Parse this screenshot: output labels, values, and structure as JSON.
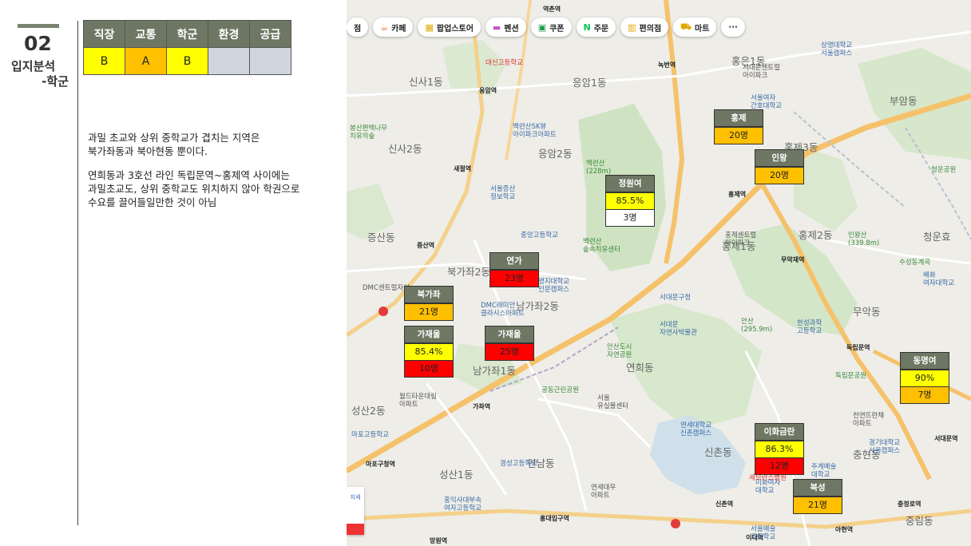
{
  "section": {
    "number": "02",
    "title_line1": "입지분석",
    "title_line2": "-학군"
  },
  "score_table": {
    "headers": [
      "직장",
      "교통",
      "학군",
      "환경",
      "공급"
    ],
    "grades": [
      "B",
      "A",
      "B",
      "",
      ""
    ]
  },
  "description": {
    "para1_line1": "과밀 초교와 상위 중학교가 겹치는 지역은",
    "para1_line2": "북가좌동과 북아현동 뿐이다.",
    "para2_line1": "연희동과 3호선 라인 독립문역~홍제역 사이에는",
    "para2_line2": "과밀초교도, 상위 중학교도 위치하지 않아 학권으로",
    "para2_line3": "수요를 끌어들일만한 것이 아님"
  },
  "chips": [
    "점",
    "카페",
    "팝업스토어",
    "펜션",
    "쿠폰",
    "주문",
    "편의점",
    "마트",
    "···"
  ],
  "areas": {
    "a1": "신사1동",
    "a2": "응암1동",
    "a3": "홍은1동",
    "a4": "신사2동",
    "a5": "응암2동",
    "a6": "부암동",
    "a7": "증산동",
    "a8": "북가좌2동",
    "a9": "홍제1동",
    "a10": "홍제2동",
    "a11": "청운효",
    "a12": "남가좌2동",
    "a13": "무악동",
    "a14": "남가좌1동",
    "a15": "연희동",
    "a16": "성산2동",
    "a17": "신촌동",
    "a18": "충현동",
    "a19": "성산1동",
    "a20": "연남동",
    "a21": "중림동",
    "a22": "홍제3동"
  },
  "stations": {
    "s1": "녹번역",
    "s2": "응암역",
    "s3": "새절역",
    "s4": "증산역",
    "s5": "홍제역",
    "s6": "무악재역",
    "s7": "독립문역",
    "s8": "가좌역",
    "s9": "마포구청역",
    "s10": "신촌역",
    "s11": "이대역",
    "s12": "아현역",
    "s13": "홍대입구역",
    "s14": "서대문역",
    "s15": "충정로역",
    "s16": "망원역",
    "s17": "역촌역"
  },
  "pois": {
    "p1": "백련산SK뷰\n아이파크아파트",
    "p2": "중앙고등학교",
    "p3": "DMC래미안\n클라시스아파트",
    "p4": "명지대학교\n인문캠퍼스",
    "p5": "서대문구청",
    "p6": "서대문\n자연사박물관",
    "p7": "안산도시\n자연공원",
    "p8": "연세대학교\n신촌캠퍼스",
    "p9": "경성고등학교",
    "p10": "홍익사대부속\n여자고등학교",
    "p11": "연세대우\n아파트",
    "p12": "이화여자\n대학교",
    "p13": "경기대학교\n서울캠퍼스",
    "p14": "한성과학\n고등학교",
    "p15": "독립문공원",
    "p16": "DMC센트럴자이",
    "p17": "월드타운대림\n아파트",
    "p18": "상명대학교\n서울캠퍼스",
    "p19": "서울예술\n고등학교",
    "p20": "홍제센트럴\n아이파크",
    "p21": "서대문센트럴\n아이파크",
    "p22": "서울여자\n간호대학교",
    "p23": "백련산\n숲속치유센터",
    "p24": "궁동근린공원",
    "p25": "마포고등학교",
    "p26": "서울증산\n정보학교",
    "p27": "세브란스병원",
    "p28": "천연뜨란채\n아파트",
    "p29": "인왕산\n(339.8m)",
    "p30": "안산\n(295.9m)",
    "p31": "백련산\n(228m)",
    "p32": "봉산편백나무\n치유의숲",
    "p33": "수성동계곡",
    "p34": "배화\n여자대학교",
    "p35": "청운공원",
    "p36": "녹번역",
    "p37": "서울\n유실물센터",
    "p38": "대신고등학교",
    "p39": "주계예술\n대학교"
  },
  "boxes": {
    "b1": {
      "name": "홍제",
      "rows": [
        "20명"
      ]
    },
    "b2": {
      "name": "인왕",
      "rows": [
        "20명"
      ]
    },
    "b3": {
      "name": "정원여",
      "rows": [
        "85.5%",
        "3명"
      ]
    },
    "b4": {
      "name": "연가",
      "rows": [
        "23명"
      ]
    },
    "b5": {
      "name": "북가좌",
      "rows": [
        "21명"
      ]
    },
    "b6": {
      "name": "가재울",
      "rows": [
        "85.4%",
        "10명"
      ]
    },
    "b7": {
      "name": "가재울",
      "rows": [
        "25명"
      ]
    },
    "b8": {
      "name": "동명여",
      "rows": [
        "90%",
        "7명"
      ]
    },
    "b9": {
      "name": "이화금란",
      "rows": [
        "86.3%",
        "12명"
      ]
    },
    "b10": {
      "name": "북성",
      "rows": [
        "21명"
      ]
    }
  },
  "side_tool_label": "지세"
}
